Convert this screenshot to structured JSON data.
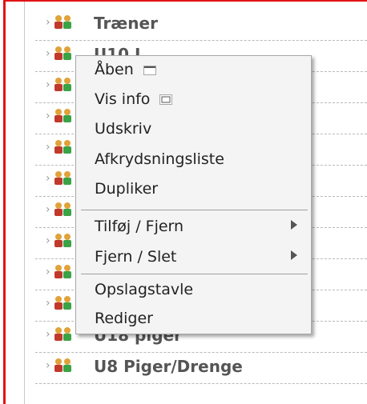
{
  "tree": {
    "rows": [
      {
        "label": "Træner"
      },
      {
        "label": "U10 J"
      },
      {
        "label": ""
      },
      {
        "label": ""
      },
      {
        "label": ""
      },
      {
        "label": ""
      },
      {
        "label": ""
      },
      {
        "label": ""
      },
      {
        "label": ""
      },
      {
        "label": ""
      },
      {
        "label": "U18 piger"
      },
      {
        "label": "U8 Piger/Drenge"
      }
    ],
    "chevron": "›",
    "icon": "group-icon"
  },
  "context_menu": {
    "items": [
      {
        "label": "Åben",
        "icon": "window-icon"
      },
      {
        "label": "Vis info",
        "icon": "info-window-icon"
      },
      {
        "label": "Udskriv"
      },
      {
        "label": "Afkrydsningsliste"
      },
      {
        "label": "Dupliker"
      },
      {
        "label": "Tilføj / Fjern",
        "submenu": true
      },
      {
        "label": "Fjern / Slet",
        "submenu": true
      },
      {
        "label": "Opslagstavle"
      },
      {
        "label": "Rediger"
      }
    ]
  },
  "colors": {
    "frame_red": "#e01414",
    "row_text": "#555555",
    "menu_bg": "#f4f4f4",
    "menu_text": "#222222"
  }
}
